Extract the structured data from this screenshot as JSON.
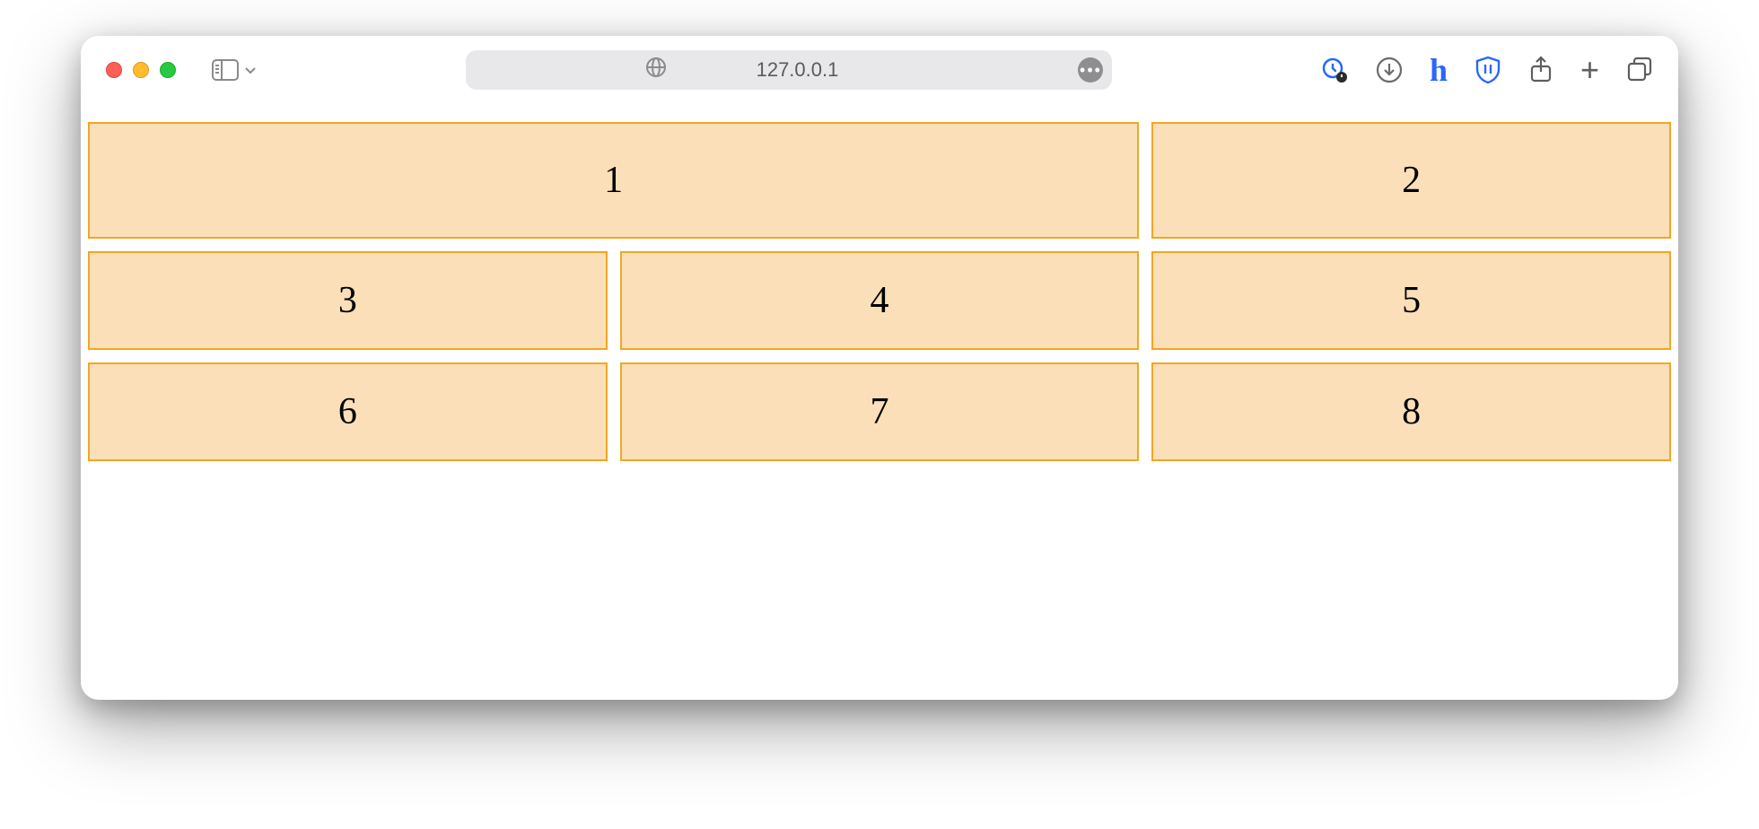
{
  "browser": {
    "address": "127.0.0.1"
  },
  "grid": {
    "cells": [
      {
        "label": "1"
      },
      {
        "label": "2"
      },
      {
        "label": "3"
      },
      {
        "label": "4"
      },
      {
        "label": "5"
      },
      {
        "label": "6"
      },
      {
        "label": "7"
      },
      {
        "label": "8"
      }
    ]
  },
  "colors": {
    "cell_fill": "#fadfb9",
    "cell_border": "#f2a623"
  }
}
